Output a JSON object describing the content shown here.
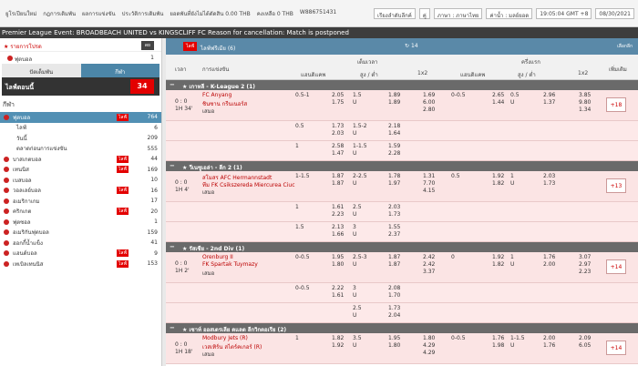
{
  "topbar": {
    "links": [
      "ยูโรเปียนใหม่",
      "กฎการเดิมพัน",
      "ผลการแข่งขัน",
      "ประวัติการเดิมพัน",
      "ยอดพันที่ยังไม่ได้ตัดสิน 0.00 THB",
      "คงเหลือ 0 THB",
      "W886751431"
    ],
    "selects": [
      "เรียงลำดับลีกค์",
      "คู่",
      "ภาษา : ภาษาไทย",
      "ค่าน้ำ : มลย์ยอด",
      "19:05:04 GMT +8",
      "08/30/2021"
    ]
  },
  "marquee": "Premier League Event: BROADBEACH UNITED vs KINGSCLIFF FC Reason for cancellation: Match is postponed",
  "sidebar": {
    "fav_title": "รายการโปรด",
    "fav_dd": "ดย",
    "fav_item": "ฟุตบอล",
    "fav_count": "1",
    "tab_a": "ปัตเด็มพัน",
    "tab_b": "กีฬา",
    "live_label": "ไลฟ์ตอนนี้",
    "live_count": "34",
    "sports_title": "กีฬา",
    "rows": [
      {
        "name": "ฟุตบอล",
        "live": "ไลฟ์",
        "count": "764"
      },
      {
        "name": "ไลฟ์",
        "live": "",
        "count": "6"
      },
      {
        "name": "วันนี้",
        "live": "",
        "count": "209"
      },
      {
        "name": "ตลาดก่อนการแข่งขัน",
        "live": "",
        "count": "555"
      },
      {
        "name": "บาสเกตบอล",
        "live": "ไลฟ์",
        "count": "44"
      },
      {
        "name": "เทนนิส",
        "live": "ไลฟ์",
        "count": "169"
      },
      {
        "name": "เบสบอล",
        "live": "",
        "count": "10"
      },
      {
        "name": "วอลเลย์บอล",
        "live": "ไลฟ์",
        "count": "16"
      },
      {
        "name": "อเมริกาเกม",
        "live": "",
        "count": "17"
      },
      {
        "name": "คริกเกต",
        "live": "ไลฟ์",
        "count": "20"
      },
      {
        "name": "ฟุตซอล",
        "live": "",
        "count": "1"
      },
      {
        "name": "อเมริกันฟุตบอล",
        "live": "",
        "count": "159"
      },
      {
        "name": "ฮอกกี้น้ำแข็ง",
        "live": "",
        "count": "41"
      },
      {
        "name": "แฮนด์บอล",
        "live": "ไลฟ์",
        "count": "9"
      },
      {
        "name": "เทเบิลเทนนิส",
        "live": "ไลฟ์",
        "count": "153"
      }
    ]
  },
  "main": {
    "live_btn": "ไลฟ์",
    "title": "ไลฟ์ฟรีเมีย (6)",
    "refresh": "14",
    "right": "เลือกลีก",
    "cols": {
      "time": "เวลา",
      "match": "การแข่งขัน",
      "full": "เต็มเวลา",
      "half": "ครึ่งแรก",
      "hdp": "แฮนดิแคพ",
      "ou": "สูง / ต่ำ",
      "x12": "1x2",
      "more": "เพิ่มเติม"
    },
    "sections": [
      {
        "title": "เกาหลี - K-League 2 (1)",
        "rows": [
          {
            "time": "0 : 0",
            "min": "1H 34'",
            "home": "FC Anyang",
            "away": "ชินซาน กรีนเนอร์ส",
            "draw": "เสมอ",
            "hdp_line": "0.5-1",
            "hdp_h": "2.05",
            "hdp_a": "1.75",
            "ou_line": "1.5",
            "ou_u": "U",
            "ou_h": "1.89",
            "ou_a": "1.89",
            "x1": "1.69",
            "x2": "6.00",
            "xd": "2.80",
            "h_hdp_line": "0-0.5",
            "h_hdp_h": "2.65",
            "h_hdp_a": "1.44",
            "h_ou_line": "0.5",
            "h_ou_u": "U",
            "h_ou_h": "2.96",
            "h_ou_a": "1.37",
            "h1": "3.85",
            "h2": "9.80",
            "hd": "1.34",
            "more": "+18"
          },
          {
            "hdp_line": "0.5",
            "hdp_h": "1.73",
            "hdp_a": "2.03",
            "ou_line": "1.5-2",
            "ou_u": "U",
            "ou_h": "2.18",
            "ou_a": "1.64"
          },
          {
            "hdp_line": "1",
            "hdp_h": "2.58",
            "hdp_a": "1.47",
            "ou_line": "1-1.5",
            "ou_u": "U",
            "ou_h": "1.59",
            "ou_a": "2.28"
          }
        ]
      },
      {
        "title": "วีเนซูเอล่า - ลีก 2 (1)",
        "rows": [
          {
            "time": "0 : 0",
            "min": "1H 4'",
            "home": "สโมสร AFC Hermannstadt",
            "away": "ทีม FK Csikszereda Miercurea Ciuc",
            "draw": "เสมอ",
            "hdp_line": "1-1.5",
            "hdp_h": "1.87",
            "hdp_a": "1.87",
            "ou_line": "2-2.5",
            "ou_u": "U",
            "ou_h": "1.78",
            "ou_a": "1.97",
            "x1": "1.31",
            "x2": "7.70",
            "xd": "4.15",
            "h_hdp_line": "0.5",
            "h_hdp_h": "1.92",
            "h_hdp_a": "1.82",
            "h_ou_line": "1",
            "h_ou_u": "U",
            "h_ou_h": "2.03",
            "h_ou_a": "1.73",
            "h1": "",
            "h2": "",
            "hd": "",
            "more": "+13"
          },
          {
            "hdp_line": "1",
            "hdp_h": "1.61",
            "hdp_a": "2.23",
            "ou_line": "2.5",
            "ou_u": "U",
            "ou_h": "2.03",
            "ou_a": "1.73"
          },
          {
            "hdp_line": "1.5",
            "hdp_h": "2.13",
            "hdp_a": "1.66",
            "ou_line": "3",
            "ou_u": "U",
            "ou_h": "1.55",
            "ou_a": "2.37"
          }
        ]
      },
      {
        "title": "รัสเซีย - 2nd Div (1)",
        "rows": [
          {
            "time": "0 : 0",
            "min": "1H 2'",
            "home": "Orenburg II",
            "away": "FK Spartak Tuymazy",
            "draw": "เสมอ",
            "hdp_line": "0-0.5",
            "hdp_h": "1.95",
            "hdp_a": "1.80",
            "ou_line": "2.5-3",
            "ou_u": "U",
            "ou_h": "1.87",
            "ou_a": "1.87",
            "x1": "2.42",
            "x2": "2.42",
            "xd": "3.37",
            "h_hdp_line": "0",
            "h_hdp_h": "1.92",
            "h_hdp_a": "1.82",
            "h_ou_line": "1",
            "h_ou_u": "U",
            "h_ou_h": "1.76",
            "h_ou_a": "2.00",
            "h1": "3.07",
            "h2": "2.97",
            "hd": "2.23",
            "more": "+14"
          },
          {
            "hdp_line": "0-0.5",
            "hdp_h": "2.22",
            "hdp_a": "1.61",
            "ou_line": "3",
            "ou_u": "U",
            "ou_h": "2.08",
            "ou_a": "1.70"
          },
          {
            "hdp_line": "",
            "hdp_h": "",
            "hdp_a": "",
            "ou_line": "2.5",
            "ou_u": "U",
            "ou_h": "1.73",
            "ou_a": "2.04"
          }
        ]
      },
      {
        "title": "เซาท์ ออสเตรเลีย ดแลต ลีกวิกตอเรีย (2)",
        "rows": [
          {
            "time": "0 : 0",
            "min": "1H 18'",
            "home": "Modbury Jets (R)",
            "away": "เวสเทิร์น สไตร์คเกอร์ (R)",
            "draw": "เสมอ",
            "hdp_line": "1",
            "hdp_h": "1.82",
            "hdp_a": "1.92",
            "ou_line": "3.5",
            "ou_u": "U",
            "ou_h": "1.95",
            "ou_a": "1.80",
            "x1": "1.80",
            "x2": "4.29",
            "xd": "4.29",
            "h_hdp_line": "0-0.5",
            "h_hdp_h": "1.76",
            "h_hdp_a": "1.98",
            "h_ou_line": "1-1.5",
            "h_ou_u": "U",
            "h_ou_h": "2.00",
            "h_ou_a": "1.76",
            "h1": "2.09",
            "h2": "6.05",
            "hd": "",
            "more": "+14"
          }
        ]
      }
    ]
  }
}
